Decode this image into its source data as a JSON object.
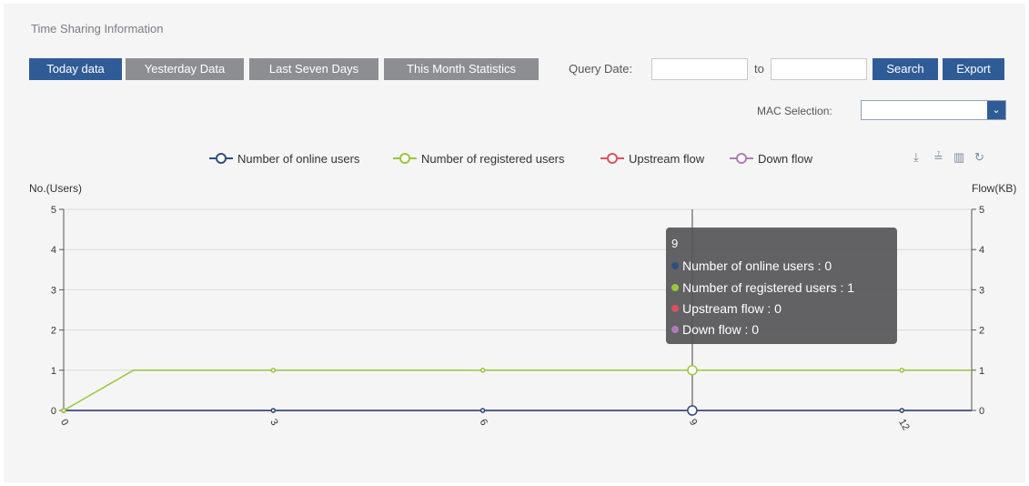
{
  "section": {
    "title": "Time Sharing Information"
  },
  "tabs": [
    {
      "label": "Today data",
      "active": true
    },
    {
      "label": "Yesterday Data",
      "active": false
    },
    {
      "label": "Last Seven Days",
      "active": false
    },
    {
      "label": "This Month Statistics",
      "active": false
    }
  ],
  "query": {
    "date_label": "Query Date:",
    "to_label": "to",
    "from_value": "",
    "to_value": "",
    "search_label": "Search",
    "export_label": "Export"
  },
  "mac": {
    "label": "MAC Selection:",
    "value": "",
    "arrow": "⌄"
  },
  "toolbox": {
    "icons": [
      "download-icon",
      "data-view-icon",
      "bar-chart-icon",
      "refresh-icon"
    ],
    "glyphs": [
      "⤓",
      "≟",
      "▥",
      "↻"
    ]
  },
  "colors": {
    "accent": "#2f5c97",
    "online": "#2f4f80",
    "registered": "#9bc63a",
    "upstream": "#d9525e",
    "down": "#b07ab8",
    "tab_inactive": "#8c8e92"
  },
  "chart_data": {
    "type": "line",
    "ylabel_left": "No.(Users)",
    "ylabel_right": "Flow(KB)",
    "ylim": [
      0,
      5
    ],
    "y_ticks": [
      "0",
      "1",
      "2",
      "3",
      "4",
      "5"
    ],
    "x_ticks": [
      "0",
      "3",
      "6",
      "9",
      "12"
    ],
    "x": [
      0,
      1,
      2,
      3,
      4,
      5,
      6,
      7,
      8,
      9,
      10,
      11,
      12,
      13
    ],
    "grid": true,
    "legend_position": "top-center",
    "series": [
      {
        "name": "Number of online users",
        "color": "#2f4f80",
        "values": [
          0,
          0,
          0,
          0,
          0,
          0,
          0,
          0,
          0,
          0,
          0,
          0,
          0,
          0
        ]
      },
      {
        "name": "Number of registered users",
        "color": "#9bc63a",
        "values": [
          0,
          1,
          1,
          1,
          1,
          1,
          1,
          1,
          1,
          1,
          1,
          1,
          1,
          1
        ]
      },
      {
        "name": "Upstream flow",
        "color": "#d9525e",
        "values": [
          0,
          0,
          0,
          0,
          0,
          0,
          0,
          0,
          0,
          0,
          0,
          0,
          0,
          0
        ]
      },
      {
        "name": "Down flow",
        "color": "#b07ab8",
        "values": [
          0,
          0,
          0,
          0,
          0,
          0,
          0,
          0,
          0,
          0,
          0,
          0,
          0,
          0
        ]
      }
    ],
    "tooltip": {
      "x": "9",
      "rows": [
        {
          "label": "Number of online users : 0",
          "color": "#2f4f80"
        },
        {
          "label": "Number of registered users : 1",
          "color": "#9bc63a"
        },
        {
          "label": "Upstream flow : 0",
          "color": "#d9525e"
        },
        {
          "label": "Down flow : 0",
          "color": "#b07ab8"
        }
      ]
    }
  }
}
